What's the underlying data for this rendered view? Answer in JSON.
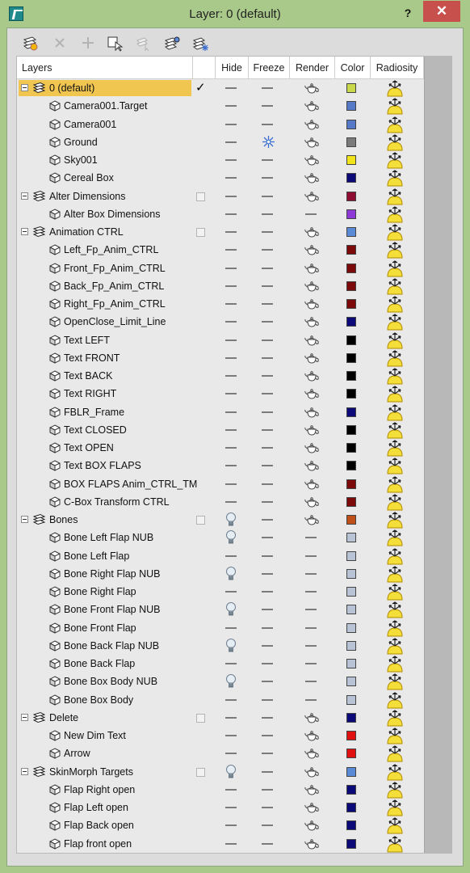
{
  "window": {
    "title": "Layer: 0 (default)",
    "help_label": "?",
    "close_label": "✕"
  },
  "toolbar": {
    "buttons": [
      {
        "name": "create-new-layer-icon"
      },
      {
        "name": "delete-layer-icon"
      },
      {
        "name": "add-to-layer-icon"
      },
      {
        "name": "select-objects-in-layer-icon"
      },
      {
        "name": "highlight-selected-objects-layers-icon"
      },
      {
        "name": "hide-unhide-all-layers-icon"
      },
      {
        "name": "freeze-unfreeze-all-layers-icon"
      }
    ]
  },
  "columns": {
    "layers": "Layers",
    "hide": "Hide",
    "freeze": "Freeze",
    "render": "Render",
    "color": "Color",
    "radiosity": "Radiosity"
  },
  "colors": {
    "selected_row": "#f0c550",
    "titlebar": "#a9c98a",
    "close_button": "#c7504d"
  },
  "rows": [
    {
      "name": "0 (default)",
      "type": "layer",
      "current": true,
      "selected": true,
      "hide": "dash",
      "freeze": "dash",
      "render": "teapot",
      "color": "#c8d84a"
    },
    {
      "name": "Camera001.Target",
      "type": "object",
      "hide": "dash",
      "freeze": "dash",
      "render": "teapot",
      "color": "#5679c8"
    },
    {
      "name": "Camera001",
      "type": "object",
      "hide": "dash",
      "freeze": "dash",
      "render": "teapot",
      "color": "#5679c8"
    },
    {
      "name": "Ground",
      "type": "object",
      "hide": "dash",
      "freeze": "snowflake",
      "render": "teapot",
      "color": "#7b7b7b"
    },
    {
      "name": "Sky001",
      "type": "object",
      "hide": "dash",
      "freeze": "dash",
      "render": "teapot",
      "color": "#f1e41a"
    },
    {
      "name": "Cereal Box",
      "type": "object",
      "hide": "dash",
      "freeze": "dash",
      "render": "teapot",
      "color": "#0b0a78"
    },
    {
      "name": "Alter Dimensions",
      "type": "layer",
      "hide": "dash",
      "freeze": "dash",
      "render": "teapot",
      "color": "#8e0b32"
    },
    {
      "name": "Alter Box Dimensions",
      "type": "object",
      "hide": "dash",
      "freeze": "dash",
      "render": "dash",
      "color": "#8e3ad6"
    },
    {
      "name": "Animation CTRL",
      "type": "layer",
      "hide": "dash",
      "freeze": "dash",
      "render": "teapot",
      "color": "#5a8ad6"
    },
    {
      "name": "Left_Fp_Anim_CTRL",
      "type": "object",
      "hide": "dash",
      "freeze": "dash",
      "render": "teapot",
      "color": "#7d0a0a"
    },
    {
      "name": "Front_Fp_Anim_CTRL",
      "type": "object",
      "hide": "dash",
      "freeze": "dash",
      "render": "teapot",
      "color": "#7d0a0a"
    },
    {
      "name": "Back_Fp_Anim_CTRL",
      "type": "object",
      "hide": "dash",
      "freeze": "dash",
      "render": "teapot",
      "color": "#7d0a0a"
    },
    {
      "name": "Right_Fp_Anim_CTRL",
      "type": "object",
      "hide": "dash",
      "freeze": "dash",
      "render": "teapot",
      "color": "#7d0a0a"
    },
    {
      "name": "OpenClose_Limit_Line",
      "type": "object",
      "hide": "dash",
      "freeze": "dash",
      "render": "teapot",
      "color": "#0b0a78"
    },
    {
      "name": "Text LEFT",
      "type": "object",
      "hide": "dash",
      "freeze": "dash",
      "render": "teapot",
      "color": "#000000"
    },
    {
      "name": "Text FRONT",
      "type": "object",
      "hide": "dash",
      "freeze": "dash",
      "render": "teapot",
      "color": "#000000"
    },
    {
      "name": "Text BACK",
      "type": "object",
      "hide": "dash",
      "freeze": "dash",
      "render": "teapot",
      "color": "#000000"
    },
    {
      "name": "Text RIGHT",
      "type": "object",
      "hide": "dash",
      "freeze": "dash",
      "render": "teapot",
      "color": "#000000"
    },
    {
      "name": "FBLR_Frame",
      "type": "object",
      "hide": "dash",
      "freeze": "dash",
      "render": "teapot",
      "color": "#0b0a78"
    },
    {
      "name": "Text CLOSED",
      "type": "object",
      "hide": "dash",
      "freeze": "dash",
      "render": "teapot",
      "color": "#000000"
    },
    {
      "name": "Text OPEN",
      "type": "object",
      "hide": "dash",
      "freeze": "dash",
      "render": "teapot",
      "color": "#000000"
    },
    {
      "name": "Text BOX FLAPS",
      "type": "object",
      "hide": "dash",
      "freeze": "dash",
      "render": "teapot",
      "color": "#000000"
    },
    {
      "name": "BOX FLAPS Anim_CTRL_TM",
      "type": "object",
      "hide": "dash",
      "freeze": "dash",
      "render": "teapot",
      "color": "#7d0a0a"
    },
    {
      "name": "C-Box Transform CTRL",
      "type": "object",
      "hide": "dash",
      "freeze": "dash",
      "render": "teapot",
      "color": "#7d0a0a"
    },
    {
      "name": "Bones",
      "type": "layer",
      "hide": "bulb",
      "freeze": "dash",
      "render": "teapot",
      "color": "#c0501a"
    },
    {
      "name": "Bone Left Flap NUB",
      "type": "object",
      "hide": "bulb",
      "freeze": "dash",
      "render": "dash",
      "color": "#b8c4d6"
    },
    {
      "name": "Bone Left Flap",
      "type": "object",
      "hide": "dash",
      "freeze": "dash",
      "render": "dash",
      "color": "#b8c4d6"
    },
    {
      "name": "Bone Right Flap NUB",
      "type": "object",
      "hide": "bulb",
      "freeze": "dash",
      "render": "dash",
      "color": "#b8c4d6"
    },
    {
      "name": "Bone Right Flap",
      "type": "object",
      "hide": "dash",
      "freeze": "dash",
      "render": "dash",
      "color": "#b8c4d6"
    },
    {
      "name": "Bone Front Flap NUB",
      "type": "object",
      "hide": "bulb",
      "freeze": "dash",
      "render": "dash",
      "color": "#b8c4d6"
    },
    {
      "name": "Bone Front Flap",
      "type": "object",
      "hide": "dash",
      "freeze": "dash",
      "render": "dash",
      "color": "#b8c4d6"
    },
    {
      "name": "Bone Back Flap NUB",
      "type": "object",
      "hide": "bulb",
      "freeze": "dash",
      "render": "dash",
      "color": "#b8c4d6"
    },
    {
      "name": "Bone Back Flap",
      "type": "object",
      "hide": "dash",
      "freeze": "dash",
      "render": "dash",
      "color": "#b8c4d6"
    },
    {
      "name": "Bone Box Body NUB",
      "type": "object",
      "hide": "bulb",
      "freeze": "dash",
      "render": "dash",
      "color": "#b8c4d6"
    },
    {
      "name": "Bone Box Body",
      "type": "object",
      "hide": "dash",
      "freeze": "dash",
      "render": "dash",
      "color": "#b8c4d6"
    },
    {
      "name": "Delete",
      "type": "layer",
      "hide": "dash",
      "freeze": "dash",
      "render": "teapot",
      "color": "#0b0a78"
    },
    {
      "name": "New Dim Text",
      "type": "object",
      "hide": "dash",
      "freeze": "dash",
      "render": "teapot",
      "color": "#e01010"
    },
    {
      "name": "Arrow",
      "type": "object",
      "hide": "dash",
      "freeze": "dash",
      "render": "teapot",
      "color": "#e01010"
    },
    {
      "name": "SkinMorph Targets",
      "type": "layer",
      "hide": "bulb",
      "freeze": "dash",
      "render": "teapot",
      "color": "#5a8ad6"
    },
    {
      "name": "Flap Right open",
      "type": "object",
      "hide": "dash",
      "freeze": "dash",
      "render": "teapot",
      "color": "#0b0a78"
    },
    {
      "name": "Flap Left open",
      "type": "object",
      "hide": "dash",
      "freeze": "dash",
      "render": "teapot",
      "color": "#0b0a78"
    },
    {
      "name": "Flap Back open",
      "type": "object",
      "hide": "dash",
      "freeze": "dash",
      "render": "teapot",
      "color": "#0b0a78"
    },
    {
      "name": "Flap front open",
      "type": "object",
      "hide": "dash",
      "freeze": "dash",
      "render": "teapot",
      "color": "#0b0a78"
    }
  ]
}
